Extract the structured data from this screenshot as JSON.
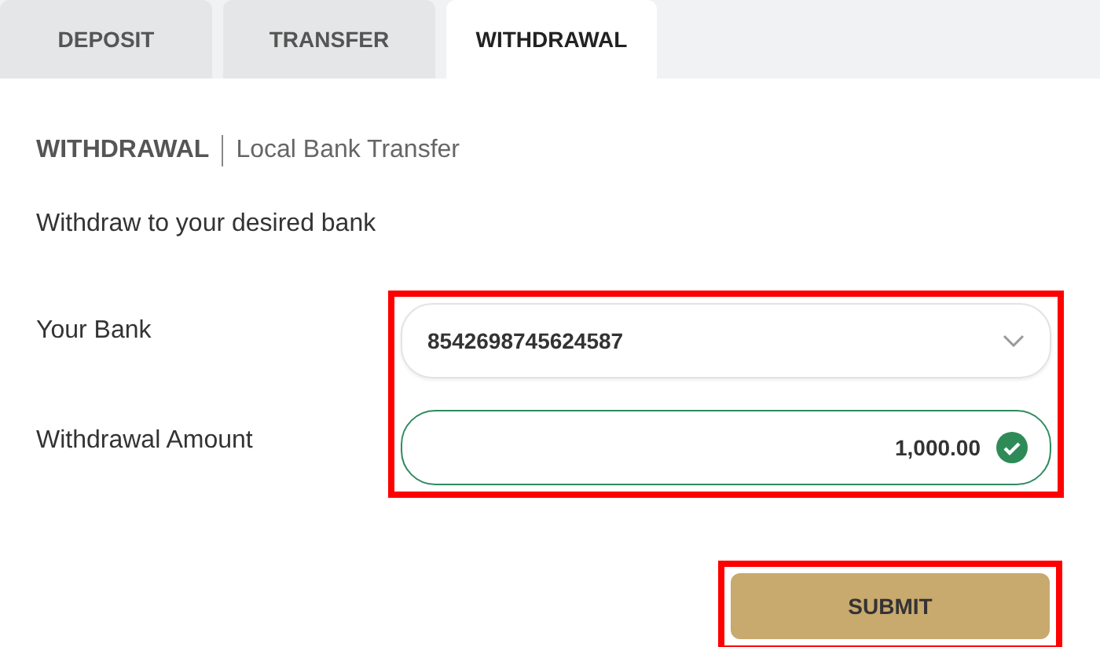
{
  "tabs": [
    {
      "label": "DEPOSIT",
      "selected": false
    },
    {
      "label": "TRANSFER",
      "selected": false
    },
    {
      "label": "WITHDRAWAL",
      "selected": true
    }
  ],
  "heading": {
    "title": "WITHDRAWAL",
    "subtitle": "Local Bank Transfer"
  },
  "instruction": "Withdraw to your desired bank",
  "fields_highlighted": true,
  "fields": [
    {
      "kind": "select",
      "label": "Your Bank",
      "value": "8542698745624587"
    },
    {
      "kind": "amount",
      "label": "Withdrawal Amount",
      "value": "1,000.00",
      "valid": true
    }
  ],
  "submit": {
    "label": "SUBMIT",
    "highlighted": true
  }
}
